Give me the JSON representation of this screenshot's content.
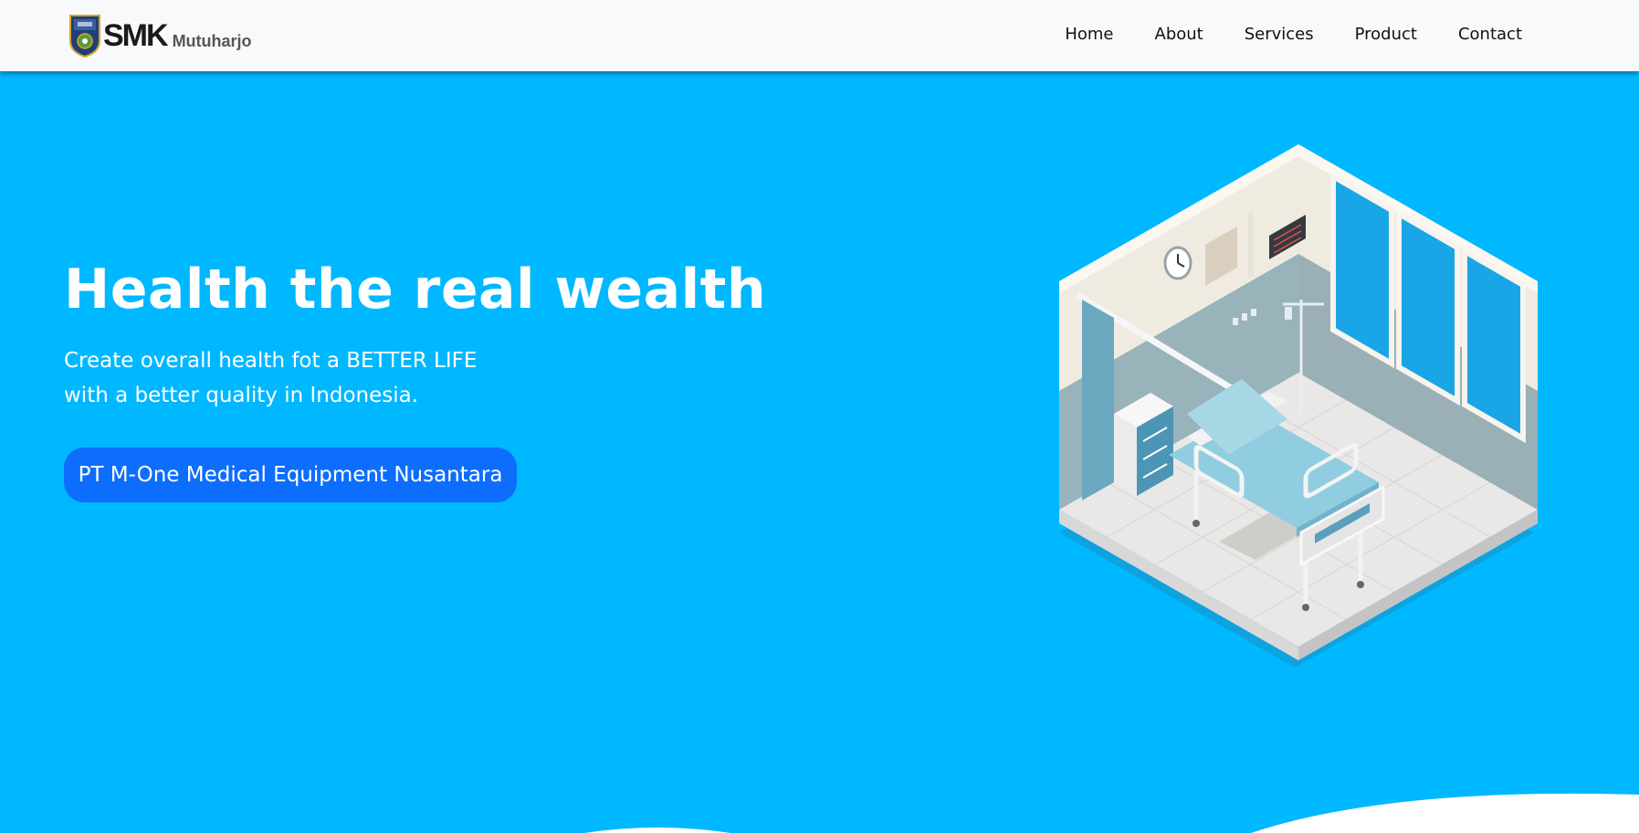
{
  "brand": {
    "name": "SMK",
    "suffix": "Mutuharjo",
    "logo_icon": "school-crest-icon"
  },
  "nav": {
    "items": [
      {
        "label": "Home"
      },
      {
        "label": "About"
      },
      {
        "label": "Services"
      },
      {
        "label": "Product"
      },
      {
        "label": "Contact"
      }
    ]
  },
  "hero": {
    "title": "Health the real wealth",
    "subtitle_line1": "Create overall health fot a BETTER LIFE",
    "subtitle_line2": "with a better quality in Indonesia.",
    "cta_label": "PT M-One Medical Equipment Nusantara",
    "illustration_icon": "isometric-hospital-room-icon"
  },
  "colors": {
    "navbar_bg": "#f8f9fa",
    "hero_bg": "#00b8ff",
    "button_bg": "#0d6efd",
    "text_light": "#ffffff",
    "nav_text": "#111111"
  }
}
